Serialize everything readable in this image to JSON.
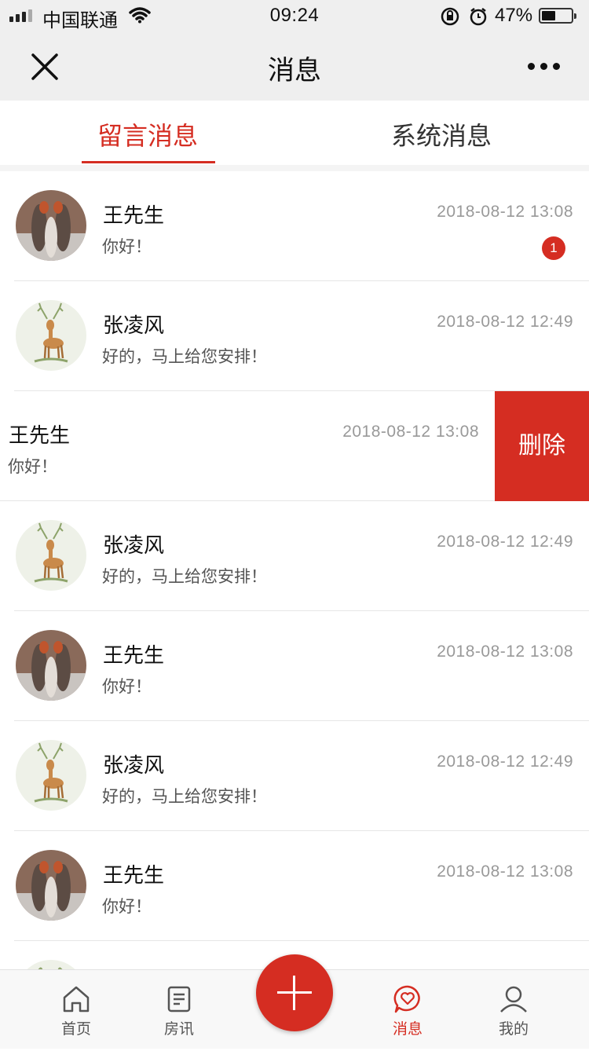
{
  "status_bar": {
    "carrier": "中国联通",
    "time": "09:24",
    "battery": "47%",
    "battery_level": 0.47
  },
  "header": {
    "title": "消息",
    "close_icon": "close-icon",
    "more_icon": "more-icon"
  },
  "tabs": [
    {
      "label": "留言消息",
      "active": true
    },
    {
      "label": "系统消息",
      "active": false
    }
  ],
  "messages": [
    {
      "name": "王先生",
      "preview": "你好！",
      "time": "2018-08-12 13:08",
      "avatar": "squirrel-avatar",
      "unread": "1"
    },
    {
      "name": "张凌风",
      "preview": "好的，马上给您安排！",
      "time": "2018-08-12 12:49",
      "avatar": "deer-avatar"
    },
    {
      "name": "王先生",
      "preview": "你好！",
      "time": "2018-08-12 13:08",
      "swiped": true,
      "action": "删除"
    },
    {
      "name": "张凌风",
      "preview": "好的，马上给您安排！",
      "time": "2018-08-12 12:49",
      "avatar": "deer-avatar"
    },
    {
      "name": "王先生",
      "preview": "你好！",
      "time": "2018-08-12 13:08",
      "avatar": "squirrel-avatar"
    },
    {
      "name": "张凌风",
      "preview": "好的，马上给您安排！",
      "time": "2018-08-12 12:49",
      "avatar": "deer-avatar"
    },
    {
      "name": "王先生",
      "preview": "你好！",
      "time": "2018-08-12 13:08",
      "avatar": "squirrel-avatar"
    }
  ],
  "tabbar": [
    {
      "label": "首页",
      "icon": "home-icon"
    },
    {
      "label": "房讯",
      "icon": "news-icon"
    },
    {
      "label": "消息",
      "icon": "message-heart-icon",
      "active": true
    },
    {
      "label": "我的",
      "icon": "user-icon"
    }
  ],
  "fab": {
    "icon": "plus-icon"
  },
  "colors": {
    "accent": "#d52d22",
    "background": "#efefef"
  }
}
